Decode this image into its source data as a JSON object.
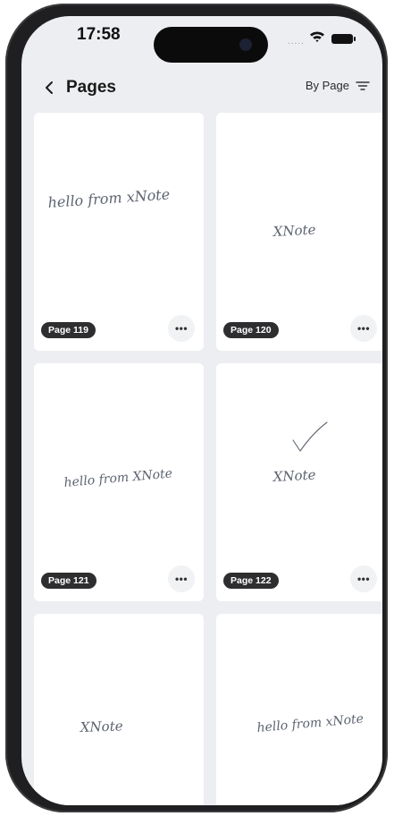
{
  "status_bar": {
    "time": "17:58",
    "signal": "....."
  },
  "header": {
    "title": "Pages",
    "sort_label": "By Page"
  },
  "pages": [
    {
      "badge": "Page 119",
      "handwriting": "hello from xNote"
    },
    {
      "badge": "Page 120",
      "handwriting": "XNote"
    },
    {
      "badge": "Page 121",
      "handwriting": "hello from XNote"
    },
    {
      "badge": "Page 122",
      "handwriting": "XNote"
    },
    {
      "badge": "",
      "handwriting": "XNote"
    },
    {
      "badge": "",
      "handwriting": "hello from xNote"
    }
  ],
  "more_label": "•••",
  "icons": {
    "back": "chevron-left-icon",
    "sort": "sort-lines-icon",
    "wifi": "wifi-icon",
    "battery": "battery-icon",
    "more": "more-horizontal-icon"
  }
}
